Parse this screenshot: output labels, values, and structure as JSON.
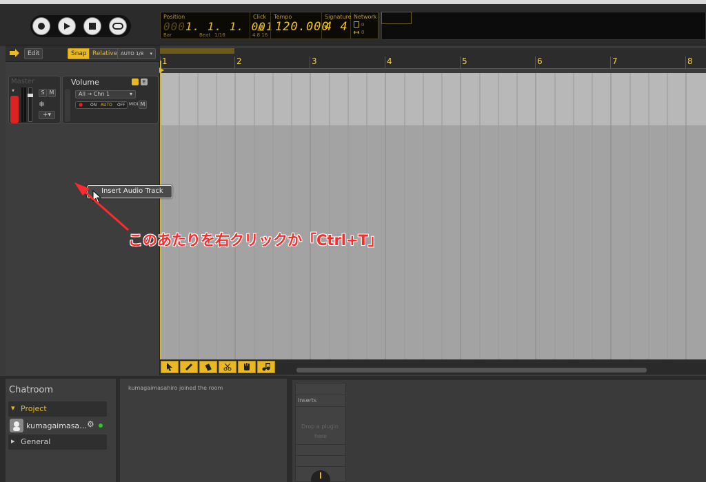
{
  "transport": {
    "buttons": [
      "record",
      "play",
      "stop",
      "loop"
    ]
  },
  "lcd": {
    "position_label": "Position",
    "position_value": "1.  1.  1. 001",
    "bar_label": "Bar",
    "beat_label": "Beat",
    "division": "1/16",
    "click_label": "Click",
    "click_sub": "4  8  16",
    "tempo_label": "Tempo",
    "tempo_value": "120.000",
    "signature_label": "Signature",
    "signature_value": "4 4",
    "network_label": "Network",
    "network_a": "0",
    "network_b": "0"
  },
  "toolbar": {
    "edit_label": "Edit",
    "snap_label": "Snap",
    "relative_label": "Relative",
    "auto_label": "AUTO",
    "auto_value": "1/8"
  },
  "master": {
    "label": "Master",
    "solo": "S",
    "mute": "M"
  },
  "volume": {
    "label": "Volume",
    "routing": "All → Chn 1",
    "on": "ON",
    "auto": "AUTO",
    "off": "OFF",
    "midi": "MIDI",
    "mute": "M"
  },
  "ruler": {
    "bars": [
      "1",
      "2",
      "3",
      "4",
      "5",
      "6",
      "7",
      "8"
    ]
  },
  "context_menu": {
    "item": "Insert Audio Track"
  },
  "annotation": {
    "text": "このあたりを右クリックか「Ctrl+T」"
  },
  "chat": {
    "title": "Chatroom",
    "project_label": "Project",
    "user": "kumagaimasa…",
    "general_label": "General",
    "log_message": "kumagaimasahiro joined the room"
  },
  "inserts": {
    "title": "Inserts",
    "drop_hint_1": "Drop a plugin",
    "drop_hint_2": "here"
  },
  "colors": {
    "accent": "#e8b922",
    "lcd_text": "#f2c21a",
    "annotation": "#ff2a2a"
  }
}
